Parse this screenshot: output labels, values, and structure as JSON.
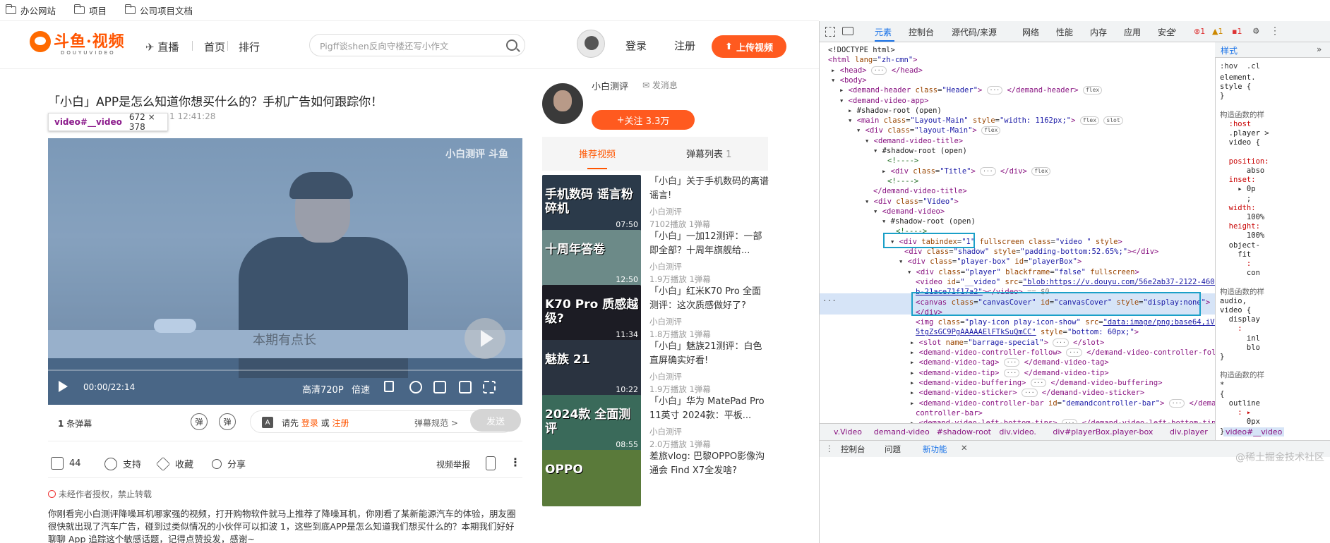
{
  "bookmarks": [
    "办公网站",
    "项目",
    "公司项目文档"
  ],
  "header": {
    "logo": "斗鱼·视频",
    "logo_sub": "DOUYUVIDEO",
    "nav": [
      "直播",
      "首页",
      "排行"
    ],
    "search_placeholder": "Pigff谈shen反向守楼还写小作文",
    "login": "登录",
    "register": "注册",
    "upload": "上传视频"
  },
  "video": {
    "title": "「小白」APP是怎么知道你想买什么的？手机广告如何跟踪你！",
    "date_tail": "1 12:41:28",
    "tooltip_name": "video#__video",
    "tooltip_size": "672 × 378",
    "watermark": "小白测评 斗鱼",
    "subtitle": "本期有点长",
    "time": "00:00/22:14",
    "quality": "高清720P",
    "speed": "倍速"
  },
  "danmu": {
    "count": "1",
    "count_label": "条弹幕",
    "icon1": "弹",
    "icon2": "弹",
    "prompt_pre": "请先",
    "login": "登录",
    "or": "或",
    "register": "注册",
    "rules": "弹幕规范 >",
    "send": "发送"
  },
  "actions": {
    "like_count": "44",
    "support": "支持",
    "collect": "收藏",
    "share": "分享",
    "report": "视频举报"
  },
  "notice": "未经作者授权，禁止转载",
  "description": "你刚看完小白测评降噪耳机哪家强的视频，打开购物软件就马上推荐了降噪耳机，你刚看了某新能源汽车的体验，朋友圈很快就出现了汽车广告，碰到过类似情况的小伙伴可以扣波 1，这些到底APP是怎么知道我们想买什么的？本期我们好好聊聊 App 追踪这个敏感话题，记得点赞投发，感谢~",
  "uploader": {
    "name": "小白测评",
    "message": "发消息",
    "follow": "关注  3.3万"
  },
  "tabs": {
    "recommended": "推荐视频",
    "danmu_list": "弹幕列表",
    "danmu_count": "1"
  },
  "recommendations": [
    {
      "title": "「小白」关于手机数码的离谱谣言!",
      "author": "小白测评",
      "stats": "7102播放   1弹幕",
      "duration": "07:50",
      "thumb_text": "手机数码\n谣言粉碎机",
      "color": "#2b3a4a"
    },
    {
      "title": "「小白」一加12测评：一部即全部？十周年旗舰给...",
      "author": "小白测评",
      "stats": "1.9万播放   1弹幕",
      "duration": "12:50",
      "thumb_text": "十周年答卷",
      "color": "#6c8a88"
    },
    {
      "title": "「小白」红米K70 Pro 全面测评：这次质感做好了?",
      "author": "小白测评",
      "stats": "1.8万播放   1弹幕",
      "duration": "11:34",
      "thumb_text": "K70 Pro\n质感越级?",
      "color": "#1c1c24"
    },
    {
      "title": "「小白」魅族21测评：白色直屏确实好看!",
      "author": "小白测评",
      "stats": "1.9万播放   1弹幕",
      "duration": "10:22",
      "thumb_text": "魅族 21",
      "color": "#2a3340"
    },
    {
      "title": "「小白」华为 MatePad Pro 11英寸 2024款：平板...",
      "author": "小白测评",
      "stats": "2.0万播放   1弹幕",
      "duration": "08:55",
      "thumb_text": "2024款 全面测评",
      "color": "#3a6a5a"
    },
    {
      "title": "差旅vlog: 巴黎OPPO影像沟通会 Find X7全发啥?",
      "author": "",
      "stats": "",
      "duration": "",
      "thumb_text": "OPPO",
      "color": "#5a7a3a"
    }
  ],
  "devtools": {
    "tabs": [
      "元素",
      "控制台",
      "源代码/来源",
      "网络",
      "性能",
      "内存",
      "应用",
      "安全"
    ],
    "style_tab": "样式",
    "filter": ":hov  .cl",
    "errors": "1",
    "warnings": "1",
    "issues": "1",
    "crumbs": [
      "v.Video",
      "demand-video",
      "#shadow-root",
      "div.video.",
      "div#playerBox.player-box",
      "div.player",
      "video#__video"
    ],
    "drawer": [
      "控制台",
      "问题",
      "新功能"
    ],
    "selected_suffix": "== $0",
    "watermark": "@稀土掘金技术社区"
  }
}
